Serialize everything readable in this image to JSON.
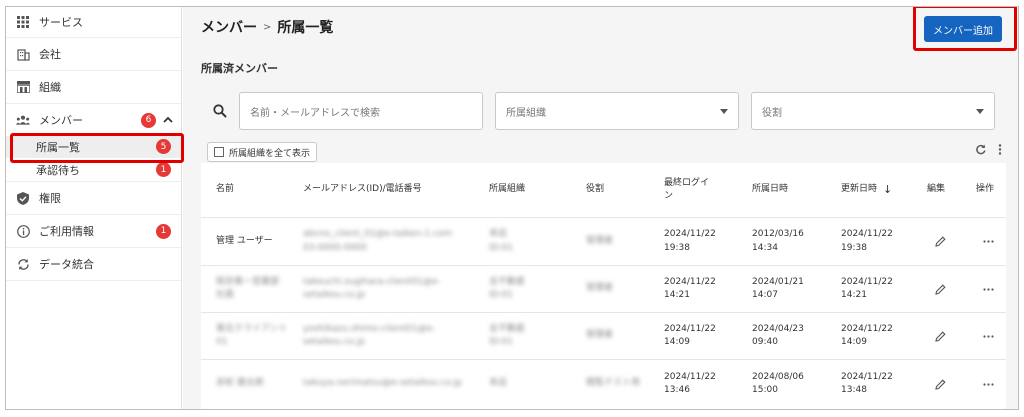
{
  "sidebar": {
    "items": [
      {
        "label": "サービス",
        "icon": "grid-icon"
      },
      {
        "label": "会社",
        "icon": "building-icon"
      },
      {
        "label": "組織",
        "icon": "organization-icon"
      },
      {
        "label": "メンバー",
        "icon": "members-icon",
        "badge": "6"
      },
      {
        "label": "権限",
        "icon": "shield-icon"
      },
      {
        "label": "ご利用情報",
        "icon": "info-icon",
        "badge": "1"
      },
      {
        "label": "データ統合",
        "icon": "sync-icon"
      }
    ],
    "sub_items": [
      {
        "label": "所属一覧",
        "badge": "5"
      },
      {
        "label": "承認待ち",
        "badge": "1"
      }
    ]
  },
  "header": {
    "breadcrumb_parent": "メンバー",
    "breadcrumb_sep": ">",
    "breadcrumb_current": "所属一覧",
    "add_button": "メンバー追加"
  },
  "section_title": "所属済メンバー",
  "filters": {
    "search_placeholder": "名前・メールアドレスで検索",
    "org_placeholder": "所属組織",
    "role_placeholder": "役割"
  },
  "toolbar": {
    "show_all_orgs": "所属組織を全て表示"
  },
  "table": {
    "headers": {
      "name": "名前",
      "email": "メールアドレス(ID)/電話番号",
      "org": "所属組織",
      "role": "役割",
      "last_login_1": "最終ログイ",
      "last_login_2": "ン",
      "joined": "所属日時",
      "updated": "更新日時",
      "updated_sort": "↓",
      "edit": "編集",
      "actions": "操作"
    },
    "rows": [
      {
        "name": "管理 ユーザー",
        "email1": "abcno_client_01@e-taiken-1.com",
        "email2": "03-0000-0000",
        "org1": "本店",
        "org2": "ID:01",
        "role": "管理者",
        "login1": "2024/11/22",
        "login2": "19:38",
        "joined1": "2012/03/16",
        "joined2": "14:34",
        "updated1": "2024/11/22",
        "updated2": "19:38"
      },
      {
        "name1": "既存第一営業部",
        "name2": "社員",
        "email1": "takeuchi.sugihara-client01@e-",
        "email2": "setaikou.co.jp",
        "org1": "全不動産",
        "org2": "ID:01",
        "role": "管理者",
        "login1": "2024/11/22",
        "login2": "14:21",
        "joined1": "2024/01/21",
        "joined2": "14:07",
        "updated1": "2024/11/22",
        "updated2": "14:21"
      },
      {
        "name1": "東北クライアント",
        "name2": "01",
        "email1": "yoshikazu.shimo-client01@e-",
        "email2": "setaikou.co.jp",
        "org1": "全不動産",
        "org2": "ID:01",
        "role": "管理者",
        "login1": "2024/11/22",
        "login2": "14:09",
        "joined1": "2024/04/23",
        "joined2": "09:40",
        "updated1": "2024/11/22",
        "updated2": "14:09"
      },
      {
        "name": "赤松 健太郎",
        "email1": "takuya.nerimatsu@e-setaikou.co.jp",
        "email2": "",
        "org1": "本店",
        "org2": "",
        "role": "閲覧テスト用",
        "login1": "2024/11/22",
        "login2": "13:46",
        "joined1": "2024/08/06",
        "joined2": "15:00",
        "updated1": "2024/11/22",
        "updated2": "13:48"
      }
    ]
  },
  "colors": {
    "accent": "#1565c0",
    "badge": "#e53935",
    "highlight": "#e00000"
  }
}
